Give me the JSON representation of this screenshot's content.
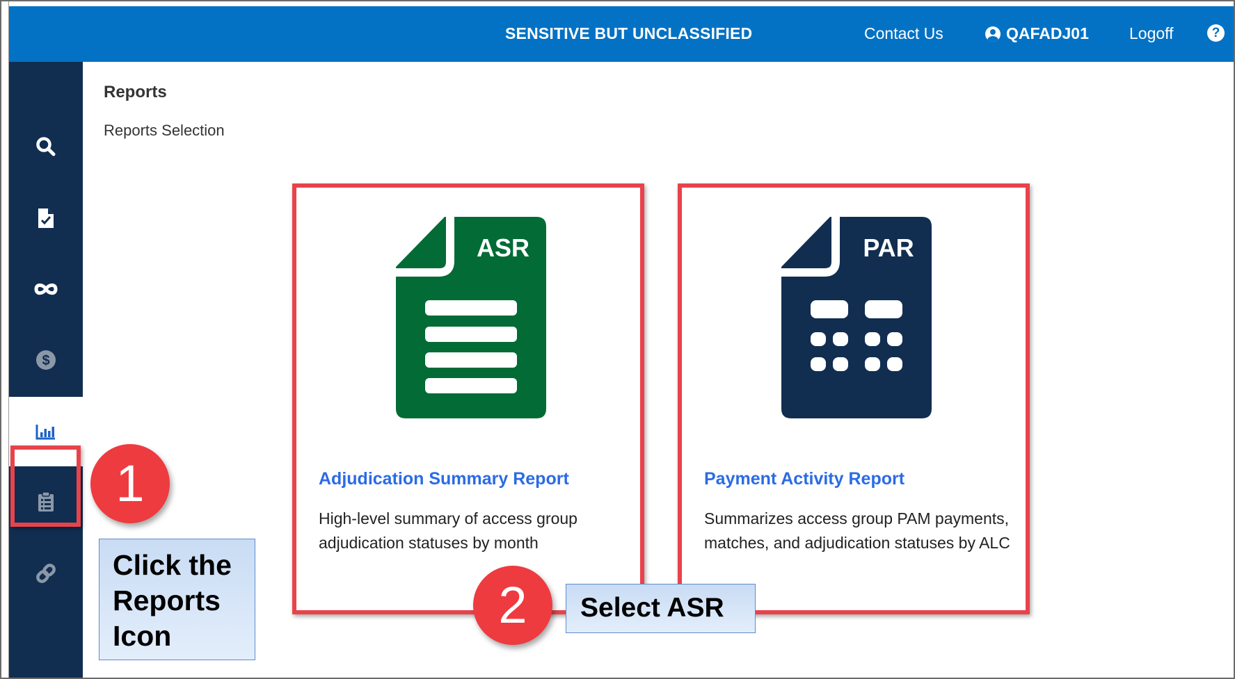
{
  "header": {
    "banner": "SENSITIVE BUT UNCLASSIFIED",
    "contact_label": "Contact Us",
    "user_name": "QAFADJ01",
    "logoff_label": "Logoff",
    "help_label": "?"
  },
  "sidebar": {
    "items": [
      {
        "icon": "search-icon"
      },
      {
        "icon": "file-check-icon"
      },
      {
        "icon": "infinity-icon"
      },
      {
        "icon": "dollar-icon"
      },
      {
        "icon": "bar-chart-icon",
        "active": true
      },
      {
        "icon": "clipboard-icon"
      },
      {
        "icon": "link-icon"
      }
    ]
  },
  "page": {
    "title": "Reports",
    "subtitle": "Reports Selection"
  },
  "cards": [
    {
      "doc_label": "ASR",
      "doc_color": "#036b36",
      "title": "Adjudication Summary Report",
      "description": "High-level summary of access group adjudication statuses by month"
    },
    {
      "doc_label": "PAR",
      "doc_color": "#112e51",
      "title": "Payment Activity Report",
      "description": "Summarizes access group PAM payments, matches, and adjudication statuses by ALC"
    }
  ],
  "annotations": {
    "step1_number": "1",
    "step1_text": "Click the Reports Icon",
    "step2_number": "2",
    "step2_text": "Select ASR",
    "highlight_color": "#e8434b"
  },
  "colors": {
    "topbar": "#0472c4",
    "sidebar": "#112e51",
    "link": "#2b6be4"
  }
}
